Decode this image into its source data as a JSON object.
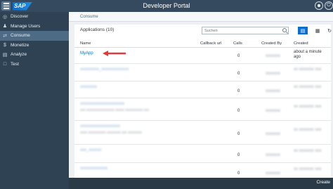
{
  "header": {
    "logo_text": "SAP",
    "title": "Developer Portal"
  },
  "sidebar": {
    "items": [
      {
        "label": "Discover",
        "icon": "target-icon",
        "selected": false
      },
      {
        "label": "Manage Users",
        "icon": "users-icon",
        "selected": false
      },
      {
        "label": "Consume",
        "icon": "connect-icon",
        "selected": true
      },
      {
        "label": "Monetize",
        "icon": "dollar-icon",
        "selected": false
      },
      {
        "label": "Analyze",
        "icon": "chart-icon",
        "selected": false
      },
      {
        "label": "Test",
        "icon": "document-icon",
        "selected": false
      }
    ]
  },
  "breadcrumb": "Consume",
  "apps": {
    "title": "Applications (10)",
    "search_placeholder": "Suchen",
    "columns": {
      "name": "Name",
      "callback": "Callback url",
      "calls": "Calls",
      "created_by": "Created By",
      "created": "Created"
    },
    "rows": [
      {
        "name": "MyApp",
        "calls": "0",
        "created_by": "",
        "created": "about a minute ago"
      },
      {
        "name": "",
        "calls": "0",
        "created_by": "",
        "created": ""
      },
      {
        "name": "",
        "calls": "0",
        "created_by": "",
        "created": ""
      },
      {
        "name": "",
        "calls": "0",
        "created_by": "",
        "created": ""
      },
      {
        "name": "",
        "calls": "0",
        "created_by": "",
        "created": ""
      },
      {
        "name": "",
        "calls": "0",
        "created_by": "",
        "created": ""
      },
      {
        "name": "",
        "calls": "0",
        "created_by": "",
        "created": ""
      }
    ]
  },
  "footer": {
    "create_label": "Create"
  },
  "colors": {
    "accent": "#0a6ed1",
    "annotation_arrow": "#e03a3a"
  }
}
